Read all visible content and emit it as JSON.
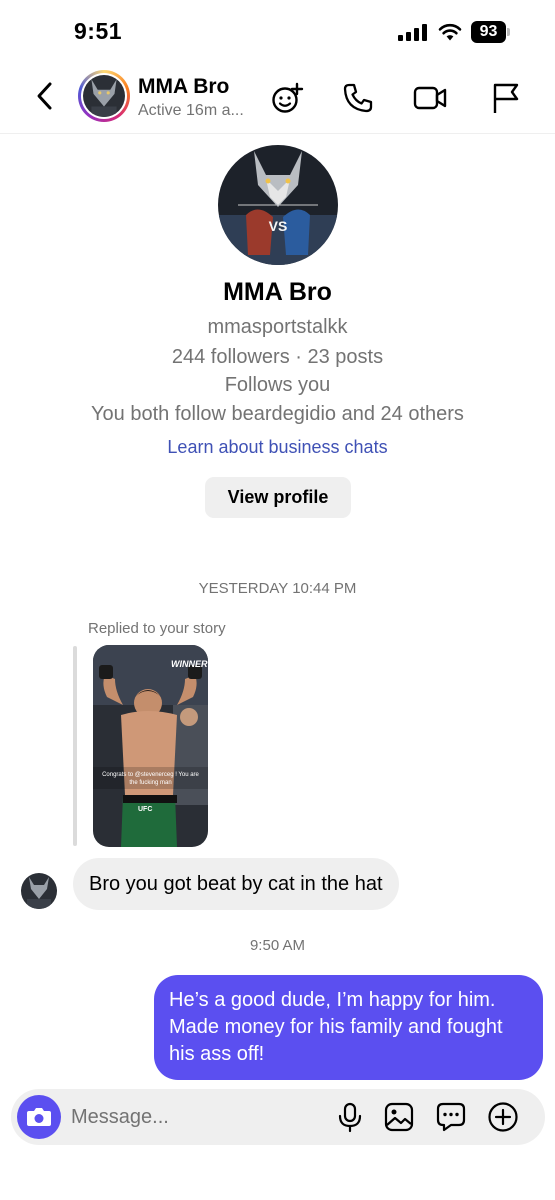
{
  "status_bar": {
    "time": "9:51",
    "battery": "93"
  },
  "header": {
    "name": "MMA Bro",
    "status": "Active 16m a..."
  },
  "profile": {
    "name": "MMA Bro",
    "username": "mmasportstalkk",
    "stats": "244 followers · 23 posts",
    "follows_you": "Follows you",
    "mutual": "You both follow beardegidio and 24 others",
    "business_link": "Learn about business chats",
    "view_profile_label": "View profile"
  },
  "chat": {
    "timestamp_1": "YESTERDAY 10:44 PM",
    "reply_label": "Replied to your story",
    "story_overlay": {
      "tag": "WINNER",
      "caption": "Congrats to @stevenerceg ! You are the fucking man"
    },
    "incoming_message": "Bro you got beat by cat in the hat",
    "timestamp_2": "9:50 AM",
    "outgoing_message": "He’s a good dude, I’m happy for him. Made money for his family and fought his ass off!"
  },
  "composer": {
    "placeholder": "Message..."
  },
  "colors": {
    "accent": "#5b4ff0",
    "link": "#3f51b5",
    "muted": "#737373",
    "bubble_in": "#efefef"
  },
  "icons": [
    "back-icon",
    "sticker-icon",
    "phone-icon",
    "video-icon",
    "flag-icon",
    "camera-icon",
    "mic-icon",
    "gallery-icon",
    "chat-icon",
    "plus-icon"
  ]
}
